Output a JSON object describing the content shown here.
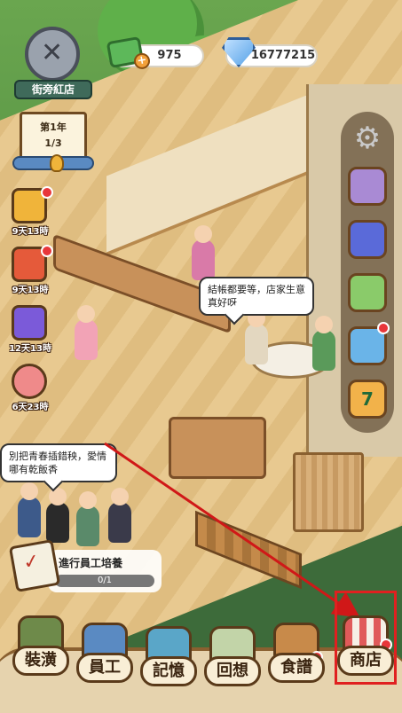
{
  "header": {
    "restaurant_name": "街旁紅店",
    "year_label": "第1年",
    "day_progress": "1/3",
    "cash": "975",
    "gems": "16777215"
  },
  "events": [
    {
      "icon": "food-ticket-icon",
      "time": "9天13時",
      "color": "#f0b43a"
    },
    {
      "icon": "gift-box-icon",
      "time": "9天13時",
      "color": "#e55a3a"
    },
    {
      "icon": "calendar-2-icon",
      "time": "12天13時",
      "color": "#7b5ad9"
    },
    {
      "icon": "piggy-bank-icon",
      "time": "6天23時",
      "color": "#ef8a8a"
    }
  ],
  "side_menu": [
    {
      "icon": "settings-icon"
    },
    {
      "icon": "rhino-pet-icon",
      "color": "#a98ad4"
    },
    {
      "icon": "ranking-book-icon",
      "color": "#5a6ad9"
    },
    {
      "icon": "cow-icon",
      "color": "#8acb6a"
    },
    {
      "icon": "crystal-ball-icon",
      "color": "#6ab4e8"
    },
    {
      "icon": "calendar-7-icon",
      "color": "#f2b24a",
      "label": "7"
    }
  ],
  "bubbles": {
    "counter_speech": "結帳都要等，店家生意真好呀",
    "queue_speech": "別把青春插錯秧，愛情哪有乾飯香"
  },
  "task": {
    "title": "進行員工培養",
    "progress": "0/1"
  },
  "nav": [
    {
      "label": "裝潢",
      "icon": "hammer-icon",
      "color": "#6e8a4a"
    },
    {
      "label": "員工",
      "icon": "staff-id-icon",
      "color": "#5a8ac2"
    },
    {
      "label": "記憶",
      "icon": "memory-fish-icon",
      "color": "#5aa6c8"
    },
    {
      "label": "回想",
      "icon": "scroll-icon",
      "color": "#c2d4a8"
    },
    {
      "label": "食譜",
      "icon": "recipe-book-icon",
      "color": "#c88a4a"
    },
    {
      "label": "商店",
      "icon": "shop-stall-icon",
      "color": "#e05a5a"
    }
  ],
  "colors": {
    "accent_red": "#e02020",
    "notification": "#e8363a"
  }
}
